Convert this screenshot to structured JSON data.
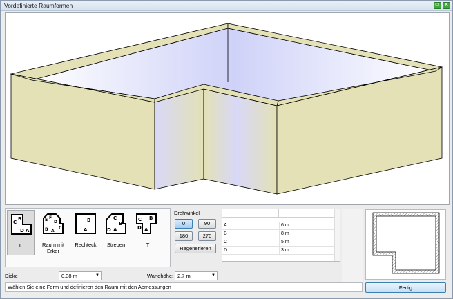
{
  "window": {
    "title": "Vordefinierte Raumformen"
  },
  "shapes": [
    {
      "label": "L",
      "letters": [
        "C",
        "B",
        "D",
        "A"
      ],
      "selected": true
    },
    {
      "label": "Raum mit Erker",
      "letters": [
        "E",
        "F",
        "D",
        "C",
        "B",
        "A"
      ],
      "selected": false
    },
    {
      "label": "Rechteck",
      "letters": [
        "B",
        "A"
      ],
      "selected": false
    },
    {
      "label": "Streben",
      "letters": [
        "C",
        "B",
        "D",
        "A"
      ],
      "selected": false
    },
    {
      "label": "T",
      "letters": [
        "C",
        "B",
        "D",
        "A"
      ],
      "selected": false
    }
  ],
  "rotation": {
    "label": "Drehwinkel",
    "buttons": [
      "0",
      "90",
      "180",
      "270"
    ],
    "selected": "0",
    "regenerate_label": "Regenerieren"
  },
  "dimensions": {
    "rows": [
      {
        "name": "A",
        "value": "6 m"
      },
      {
        "name": "B",
        "value": "8 m"
      },
      {
        "name": "C",
        "value": "5 m"
      },
      {
        "name": "D",
        "value": "3 m"
      }
    ]
  },
  "thickness": {
    "label": "Dicke",
    "value": "0.38 m"
  },
  "wall_height": {
    "label": "Wandhöhe:",
    "value": "2.7 m"
  },
  "status": {
    "text": "Wählen Sie eine Form und definieren den Raum mit den Abmessungen"
  },
  "finish_button": {
    "label": "Fertig"
  },
  "colors": {
    "wall": "#e3e1b5",
    "floor": "#d7d9f6",
    "accent": "#3c7fb1"
  }
}
